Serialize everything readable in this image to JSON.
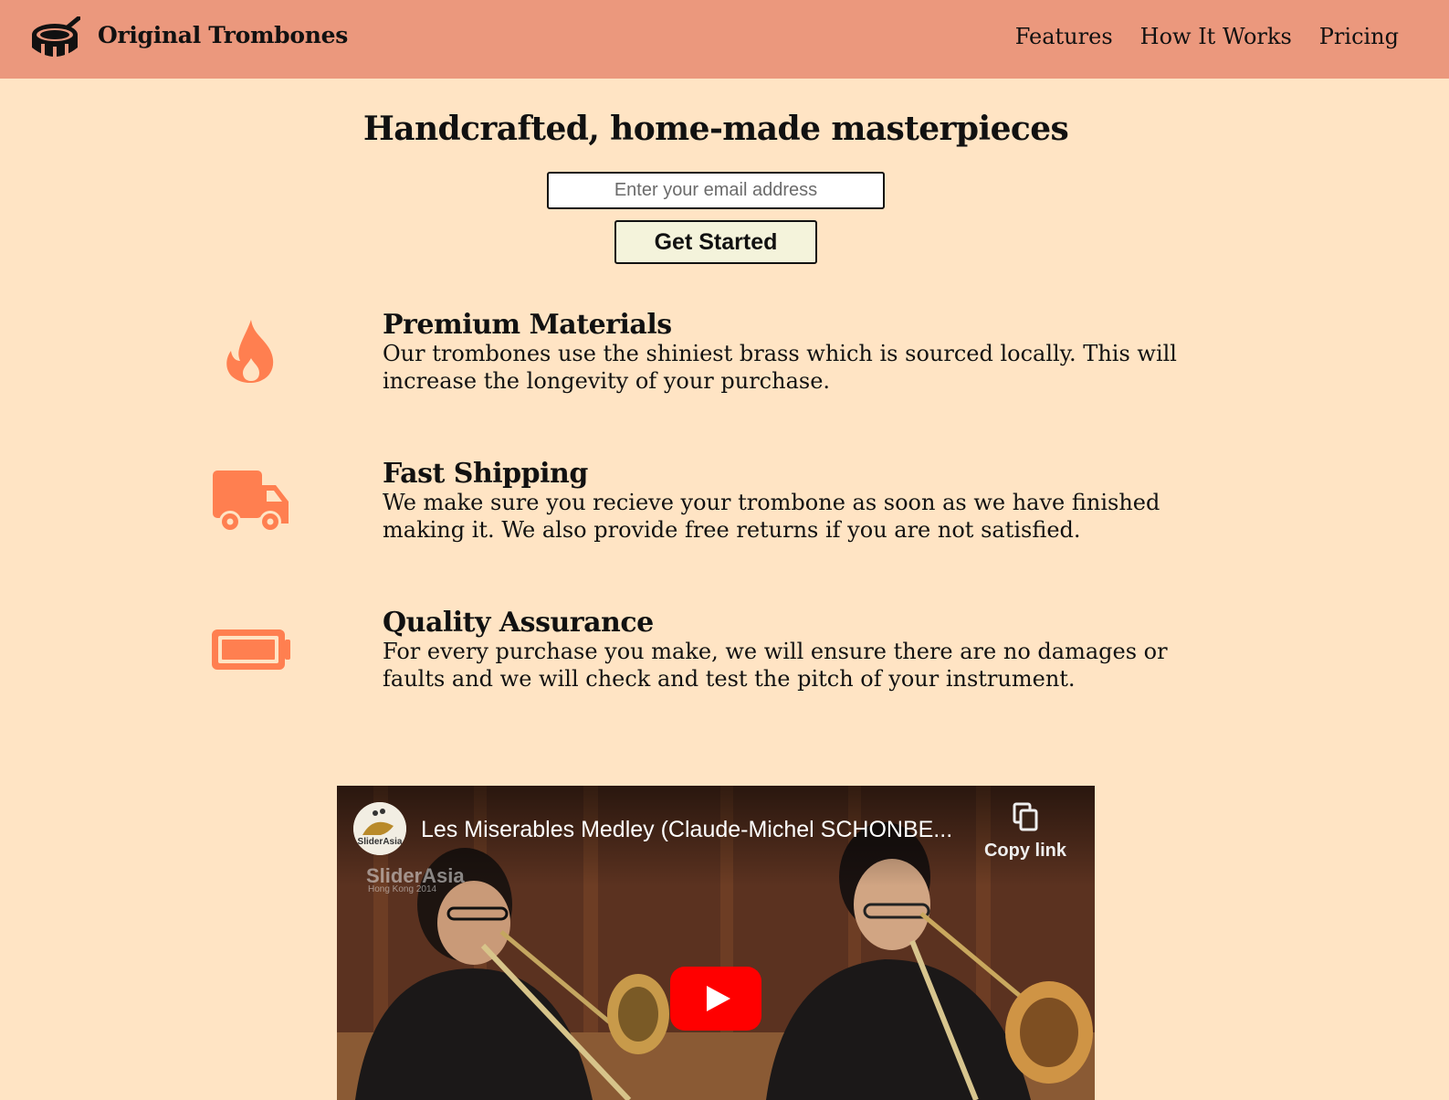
{
  "header": {
    "brand": "Original Trombones",
    "logo_icon": "drum-icon",
    "nav": [
      {
        "label": "Features"
      },
      {
        "label": "How It Works"
      },
      {
        "label": "Pricing"
      }
    ]
  },
  "hero": {
    "title": "Handcrafted, home-made masterpieces",
    "email_placeholder": "Enter your email address",
    "cta_label": "Get Started"
  },
  "features": [
    {
      "icon": "fire-icon",
      "title": "Premium Materials",
      "description": "Our trombones use the shiniest brass which is sourced locally. This will increase the longevity of your purchase."
    },
    {
      "icon": "truck-icon",
      "title": "Fast Shipping",
      "description": "We make sure you recieve your trombone as soon as we have finished making it. We also provide free returns if you are not satisfied."
    },
    {
      "icon": "battery-full-icon",
      "title": "Quality Assurance",
      "description": "For every purchase you make, we will ensure there are no damages or faults and we will check and test the pitch of your instrument."
    }
  ],
  "video": {
    "title": "Les Miserables Medley (Claude-Michel SCHONBE...",
    "channel_avatar_text": "SliderAsia",
    "watermark": "SliderAsia",
    "watermark_sub": "Hong Kong 2014",
    "copy_link_label": "Copy link"
  },
  "colors": {
    "header_bg": "#EB987D",
    "page_bg": "#FFE4C4",
    "icon_accent": "#FF7F50",
    "button_bg": "#F4F3DB",
    "youtube_red": "#FF0000"
  }
}
